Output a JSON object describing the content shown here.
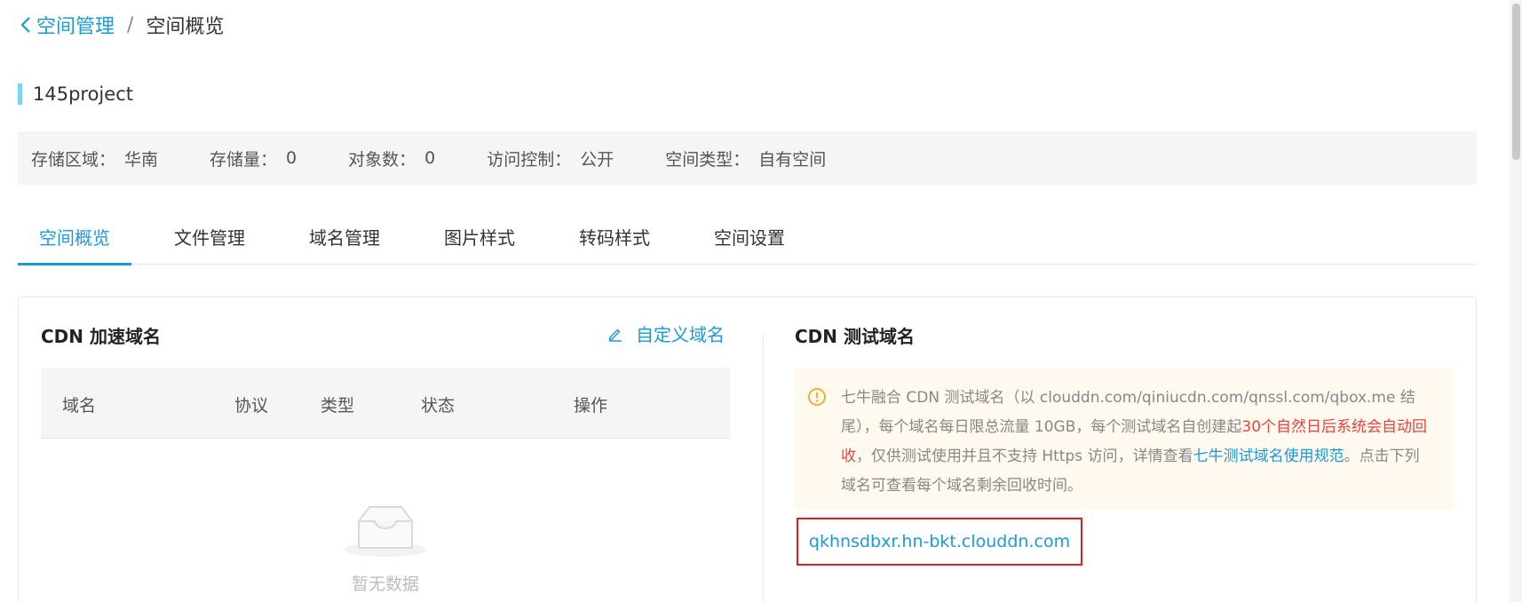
{
  "breadcrumb": {
    "back_label": "空间管理",
    "separator": "/",
    "current": "空间概览"
  },
  "project": {
    "name": "145project"
  },
  "info": [
    {
      "label": "存储区域：",
      "value": "华南"
    },
    {
      "label": "存储量：",
      "value": "0"
    },
    {
      "label": "对象数：",
      "value": "0"
    },
    {
      "label": "访问控制：",
      "value": "公开"
    },
    {
      "label": "空间类型：",
      "value": "自有空间"
    }
  ],
  "tabs": [
    {
      "label": "空间概览",
      "active": true
    },
    {
      "label": "文件管理",
      "active": false
    },
    {
      "label": "域名管理",
      "active": false
    },
    {
      "label": "图片样式",
      "active": false
    },
    {
      "label": "转码样式",
      "active": false
    },
    {
      "label": "空间设置",
      "active": false
    }
  ],
  "cdn_accel": {
    "title": "CDN 加速域名",
    "custom_domain_label": "自定义域名",
    "columns": [
      "域名",
      "协议",
      "类型",
      "状态",
      "操作"
    ],
    "empty_text": "暂无数据"
  },
  "cdn_test": {
    "title": "CDN 测试域名",
    "notice": {
      "part1": "七牛融合 CDN 测试域名（以 clouddn.com/qiniucdn.com/qnssl.com/qbox.me 结尾），每个域名每日限总流量 10GB，每个测试域名自创建起",
      "part2_red": "30个自然日后系统会自动回收",
      "part3": "，仅供测试使用并且不支持 Https 访问，详情查看",
      "part4_link": "七牛测试域名使用规范",
      "part5": "。点击下列域名可查看每个域名剩余回收时间。"
    },
    "domain": "qkhnsdbxr.hn-bkt.clouddn.com"
  },
  "colors": {
    "accent": "#1a9ad6",
    "warning_red": "#e8443c",
    "highlight_border": "#e02020"
  }
}
